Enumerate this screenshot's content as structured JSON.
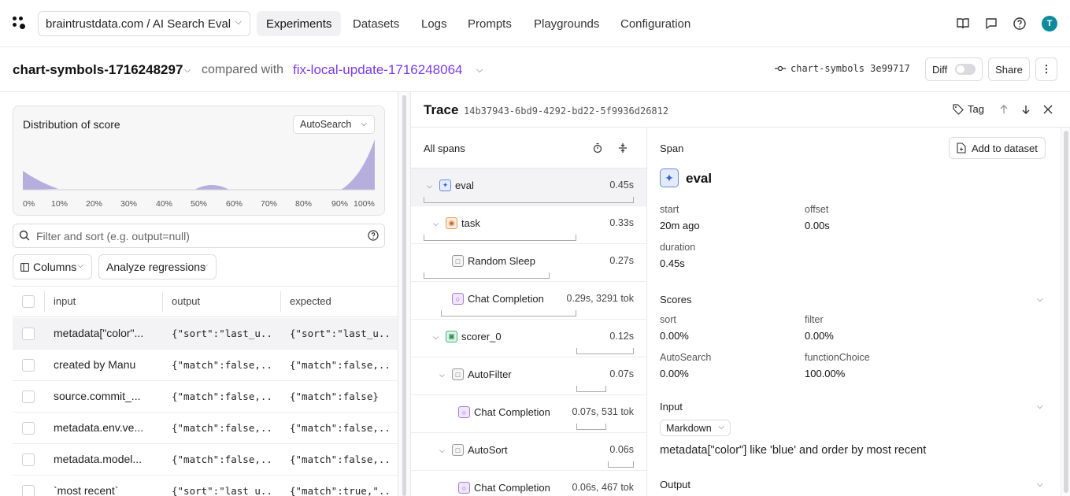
{
  "nav": {
    "project": "braintrustdata.com / AI Search Eval",
    "items": [
      "Experiments",
      "Datasets",
      "Logs",
      "Prompts",
      "Playgrounds",
      "Configuration"
    ],
    "avatar": "T"
  },
  "subheader": {
    "experiment": "chart-symbols-1716248297",
    "compared_with": "compared with",
    "comparison": "fix-local-update-1716248064",
    "branch": "chart-symbols 3e99717",
    "diff": "Diff",
    "share": "Share"
  },
  "distribution": {
    "title": "Distribution of score",
    "select": "AutoSearch",
    "ticks": [
      "0%",
      "10%",
      "20%",
      "30%",
      "40%",
      "50%",
      "60%",
      "70%",
      "80%",
      "90%",
      "100%"
    ]
  },
  "filter": {
    "placeholder": "Filter and sort (e.g. output=null)"
  },
  "toolbar": {
    "columns": "Columns",
    "analyze": "Analyze regressions"
  },
  "table": {
    "headers": [
      "input",
      "output",
      "expected"
    ],
    "rows": [
      {
        "input": "metadata[\"color\"...",
        "output": "{\"sort\":\"last_u...",
        "expected": "{\"sort\":\"last_u..."
      },
      {
        "input": "created by Manu",
        "output": "{\"match\":false,...",
        "expected": "{\"match\":false,..."
      },
      {
        "input": "source.commit_...",
        "output": "{\"match\":false,...",
        "expected": "{\"match\":false}"
      },
      {
        "input": "metadata.env.ve...",
        "output": "{\"match\":false,...",
        "expected": "{\"match\":false,..."
      },
      {
        "input": "metadata.model...",
        "output": "{\"match\":false,...",
        "expected": "{\"match\":false,..."
      },
      {
        "input": "`most recent`",
        "output": "{\"sort\":\"last_u...",
        "expected": "{\"match\":true,\"..."
      }
    ]
  },
  "trace": {
    "title": "Trace",
    "id": "14b37943-6bd9-4292-bd22-5f9936d26812",
    "tag": "Tag",
    "spans_title": "All spans",
    "spans": [
      {
        "name": "eval",
        "duration": "0.45s"
      },
      {
        "name": "task",
        "duration": "0.33s"
      },
      {
        "name": "Random Sleep",
        "duration": "0.27s"
      },
      {
        "name": "Chat Completion",
        "duration": "0.29s, 3291 tok"
      },
      {
        "name": "scorer_0",
        "duration": "0.12s"
      },
      {
        "name": "AutoFilter",
        "duration": "0.07s"
      },
      {
        "name": "Chat Completion",
        "duration": "0.07s, 531 tok"
      },
      {
        "name": "AutoSort",
        "duration": "0.06s"
      },
      {
        "name": "Chat Completion",
        "duration": "0.06s, 467 tok"
      }
    ]
  },
  "detail": {
    "span_label": "Span",
    "add_to_dataset": "Add to dataset",
    "name": "eval",
    "start_label": "start",
    "start_value": "20m ago",
    "offset_label": "offset",
    "offset_value": "0.00s",
    "duration_label": "duration",
    "duration_value": "0.45s",
    "scores_title": "Scores",
    "scores": [
      {
        "label": "sort",
        "value": "0.00%"
      },
      {
        "label": "filter",
        "value": "0.00%"
      },
      {
        "label": "AutoSearch",
        "value": "0.00%"
      },
      {
        "label": "functionChoice",
        "value": "100.00%"
      }
    ],
    "input_title": "Input",
    "input_format": "Markdown",
    "input_text": "metadata[\"color\"] like 'blue' and order by most recent",
    "output_title": "Output"
  }
}
